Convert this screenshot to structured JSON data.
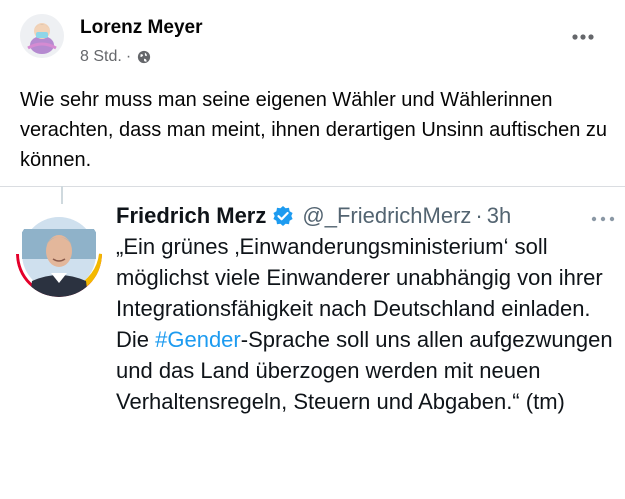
{
  "post": {
    "author": "Lorenz Meyer",
    "time": "8 Std.",
    "separator": "·",
    "privacy_icon": "globe-icon",
    "more_icon": "more-horizontal-icon",
    "text": "Wie sehr muss man seine eigenen Wähler und Wählerinnen verachten, dass man meint, ihnen derartigen Unsinn auftischen zu können."
  },
  "tweet": {
    "name": "Friedrich Merz",
    "verified_icon": "verified-badge-icon",
    "handle": "@_FriedrichMerz",
    "separator": "·",
    "time": "3h",
    "more_icon": "more-horizontal-icon",
    "text_before": "„Ein grünes ‚Einwanderungsministerium‘ soll möglichst viele Einwanderer unabhängig von ihrer Integrationsfähigkeit nach Deutschland einladen. Die ",
    "hashtag": "#Gender",
    "text_after": "-Sprache soll uns allen aufgezwungen und das Land überzogen werden mit neuen Verhaltensregeln, Steuern und Abgaben.“ (tm)"
  },
  "colors": {
    "text_primary": "#050505",
    "text_secondary": "#65676b",
    "twitter_blue": "#1d9bf0",
    "tweet_handle": "#536471",
    "divider": "#dadde1"
  }
}
